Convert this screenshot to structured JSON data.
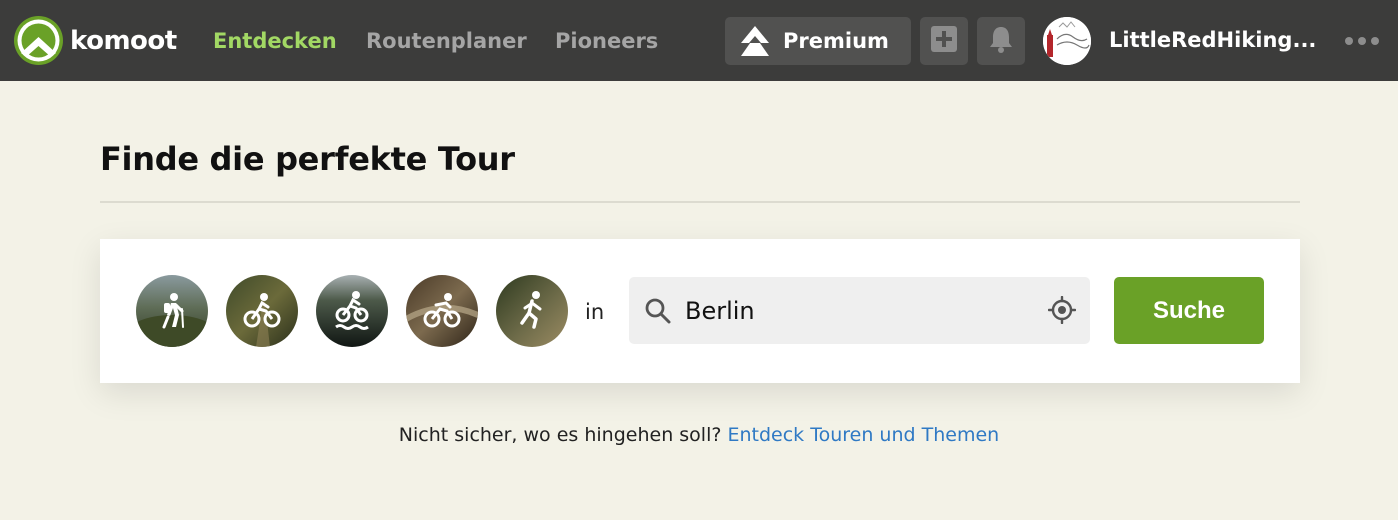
{
  "brand": {
    "name": "komoot",
    "color": "#6aa127"
  },
  "nav": {
    "items": [
      {
        "label": "Entdecken",
        "active": true
      },
      {
        "label": "Routenplaner",
        "active": false
      },
      {
        "label": "Pioneers",
        "active": false
      }
    ]
  },
  "header": {
    "premium_label": "Premium",
    "add_icon": "plus-icon",
    "notification_icon": "bell-icon",
    "username": "LittleRedHiking...",
    "more_icon": "more-dots-icon"
  },
  "main": {
    "title": "Finde die perfekte Tour",
    "sports": [
      {
        "icon": "hiking-icon"
      },
      {
        "icon": "mountain-bike-icon"
      },
      {
        "icon": "gravel-bike-icon"
      },
      {
        "icon": "road-bike-icon"
      },
      {
        "icon": "running-icon"
      }
    ],
    "in_label": "in",
    "search": {
      "value": "Berlin",
      "placeholder": ""
    },
    "search_button": "Suche",
    "hint_text": "Nicht sicher, wo es hingehen soll?",
    "hint_link": "Entdeck Touren und Themen"
  },
  "colors": {
    "topbar": "#3c3c3b",
    "background": "#f3f2e7",
    "accent_green": "#6aa127",
    "active_nav": "#a2d864",
    "link": "#2f79c4"
  }
}
